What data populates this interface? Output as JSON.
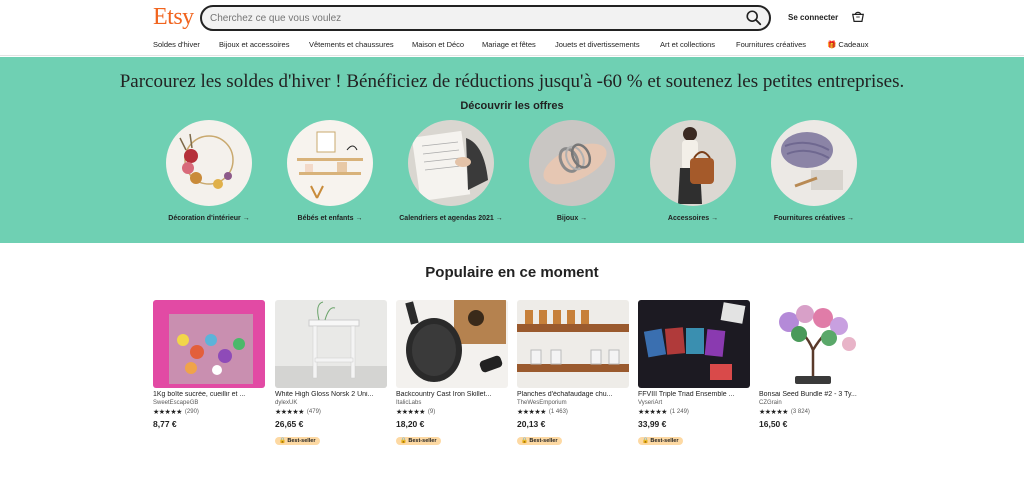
{
  "header": {
    "logo": "Etsy",
    "search_placeholder": "Cherchez ce que vous voulez",
    "signin_label": "Se connecter",
    "icons": [
      "search-icon",
      "cart-icon"
    ]
  },
  "nav": [
    {
      "label": "Soldes d'hiver"
    },
    {
      "label": "Bijoux et accessoires"
    },
    {
      "label": "Vêtements et chaussures"
    },
    {
      "label": "Maison et Déco"
    },
    {
      "label": "Mariage et fêtes"
    },
    {
      "label": "Jouets et divertissements"
    },
    {
      "label": "Art et collections"
    },
    {
      "label": "Fournitures créatives"
    },
    {
      "label": "🎁 Cadeaux"
    }
  ],
  "banner": {
    "title": "Parcourez les soldes d'hiver ! Bénéficiez de réductions jusqu'à -60 % et soutenez les petites entreprises.",
    "subtitle": "Découvrir les offres",
    "background": "#6fd0b3",
    "categories": [
      {
        "label": "Décoration d'intérieur →"
      },
      {
        "label": "Bébés et enfants →"
      },
      {
        "label": "Calendriers et agendas 2021 →"
      },
      {
        "label": "Bijoux →"
      },
      {
        "label": "Accessoires →"
      },
      {
        "label": "Fournitures créatives →"
      }
    ]
  },
  "popular": {
    "title": "Populaire en ce moment",
    "items": [
      {
        "title": "1Kg boîte sucrée, cueillir et ...",
        "shop": "SweetEscapeGB",
        "stars": "★★★★★",
        "count": "(290)",
        "price": "8,77 €",
        "badge": ""
      },
      {
        "title": "White High Gloss Norsk 2 Uni...",
        "shop": "dylexUK",
        "stars": "★★★★★",
        "count": "(479)",
        "price": "26,65 €",
        "badge": "🔒 Best-seller"
      },
      {
        "title": "Backcountry Cast Iron Skillet...",
        "shop": "ItalicLabs",
        "stars": "★★★★★",
        "count": "(9)",
        "price": "18,20 €",
        "badge": "🔒 Best-seller"
      },
      {
        "title": "Planches d'échafaudage chu...",
        "shop": "TheWesEmporium",
        "stars": "★★★★★",
        "count": "(1 463)",
        "price": "20,13 €",
        "badge": "🔒 Best-seller"
      },
      {
        "title": "FFVIII Triple Triad Ensemble ...",
        "shop": "VyseriArt",
        "stars": "★★★★★",
        "count": "(1 249)",
        "price": "33,99 €",
        "badge": "🔒 Best-seller"
      },
      {
        "title": "Bonsai Seed Bundle #2 - 3 Ty...",
        "shop": "CZGrain",
        "stars": "★★★★★",
        "count": "(3 824)",
        "price": "16,50 €",
        "badge": ""
      }
    ]
  },
  "colors": {
    "accent": "#f1641e",
    "banner": "#6fd0b3",
    "badge": "#fdd9a3"
  }
}
